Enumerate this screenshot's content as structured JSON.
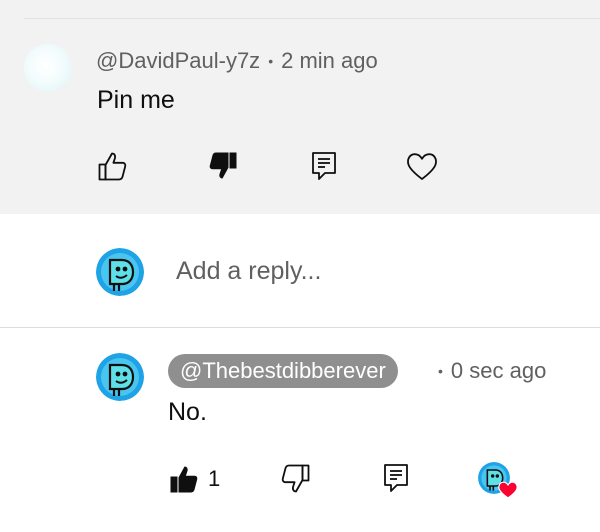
{
  "parent_comment": {
    "author": "@DavidPaul-y7z",
    "separator": "•",
    "time": "2 min ago",
    "text": "Pin me",
    "actions": {
      "like_icon": "thumbs-up-outline-icon",
      "dislike_icon": "thumbs-down-filled-icon",
      "reply_icon": "reply-comment-icon",
      "heart_icon": "heart-outline-icon"
    }
  },
  "reply_box": {
    "placeholder": "Add a reply..."
  },
  "reply": {
    "author": "@Thebestdibberever",
    "separator": "•",
    "time": "0 sec ago",
    "text": "No.",
    "like_count": "1",
    "actions": {
      "like_icon": "thumbs-up-filled-icon",
      "dislike_icon": "thumbs-down-outline-icon",
      "reply_icon": "reply-comment-icon",
      "heart_badge_icon": "creator-heart-icon"
    }
  },
  "colors": {
    "parent_background": "#f2f2f2",
    "author_chip": "#8f8f8f",
    "heart_red": "#ff0033",
    "avatar_blue": "#1fa3e6"
  }
}
